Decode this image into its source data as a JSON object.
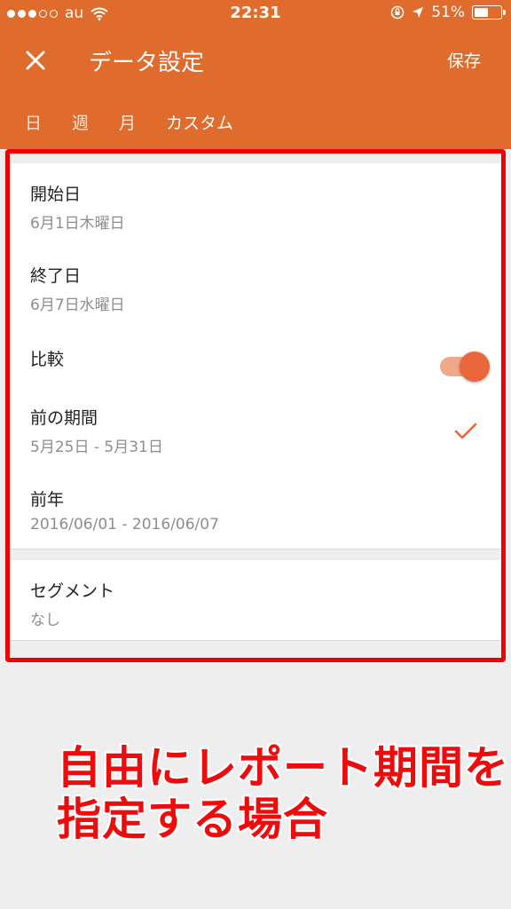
{
  "status_bar": {
    "carrier": "au",
    "time": "22:31",
    "battery": "51%"
  },
  "toolbar": {
    "title": "データ設定",
    "save_label": "保存"
  },
  "tabs": [
    {
      "label": "日",
      "active": false
    },
    {
      "label": "週",
      "active": false
    },
    {
      "label": "月",
      "active": false
    },
    {
      "label": "カスタム",
      "active": true
    }
  ],
  "settings": {
    "start_date": {
      "label": "開始日",
      "value": "6月1日木曜日"
    },
    "end_date": {
      "label": "終了日",
      "value": "6月7日水曜日"
    },
    "compare": {
      "label": "比較",
      "enabled": true
    },
    "previous_period": {
      "label": "前の期間",
      "value": "5月25日 - 5月31日",
      "selected": true
    },
    "previous_year": {
      "label": "前年",
      "value": "2016/06/01 - 2016/06/07"
    },
    "segment": {
      "label": "セグメント",
      "value": "なし"
    }
  },
  "annotation": {
    "line1": "自由にレポート期間を",
    "line2": "指定する場合"
  },
  "colors": {
    "header": "#df6b2d",
    "accent": "#e9673a",
    "highlight": "#ef0000"
  }
}
